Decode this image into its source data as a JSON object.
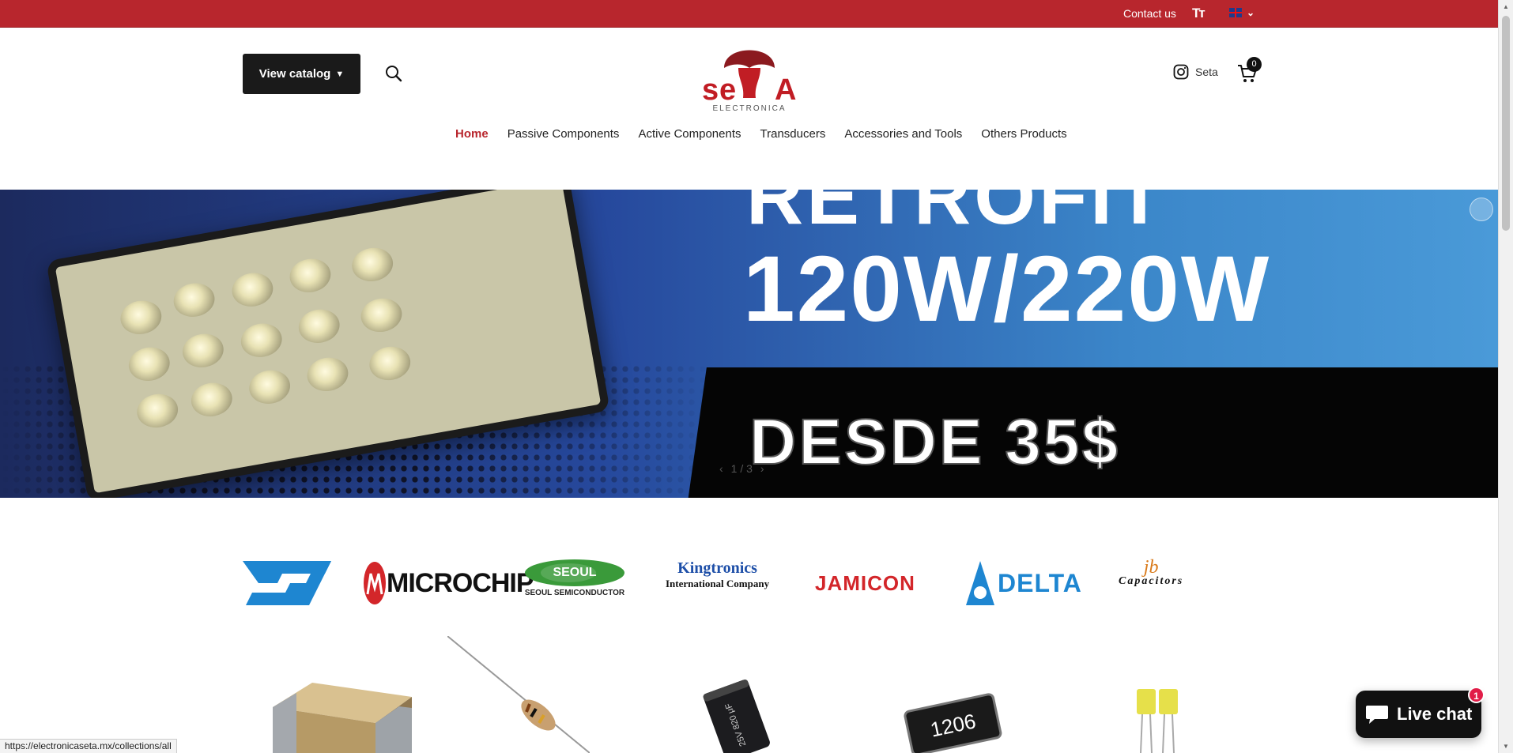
{
  "topbar": {
    "contact_label": "Contact us",
    "textsize_icon": "text-size-icon",
    "language_icon": "uk-flag-icon"
  },
  "header": {
    "catalog_label": "View catalog",
    "search_icon": "search-icon",
    "logo_text": "SETA",
    "logo_subtext": "ELECTRONICA",
    "instagram_label": "Seta",
    "cart_count": "0"
  },
  "nav": {
    "items": [
      {
        "label": "Home",
        "active": true
      },
      {
        "label": "Passive Components"
      },
      {
        "label": "Active Components"
      },
      {
        "label": "Transducers"
      },
      {
        "label": "Accessories and Tools"
      },
      {
        "label": "Others Products"
      }
    ]
  },
  "hero": {
    "line1": "RETROFIT",
    "line2": "120W/220W",
    "line3": "DESDE 35$",
    "pager": "1 / 3",
    "colors": {
      "blue_dark": "#1c2a5e",
      "blue_light": "#4a9ad8"
    }
  },
  "brands": {
    "microchip": "MICROCHIP",
    "seoul_top": "SEOUL",
    "seoul_bottom": "SEOUL SEMICONDUCTOR",
    "king_top": "Kingtronics",
    "king_bottom": "International Company",
    "jamicon": "JAMICON",
    "delta": "DELTA",
    "jb_top": "jb",
    "jb_bottom": "Capacitors"
  },
  "products": {
    "smd_resistor_label": "1206",
    "capacitor_label": "25V 820 μF"
  },
  "status_url": "https://electronicaseta.mx/collections/all",
  "chat": {
    "label": "Live chat",
    "badge": "1"
  },
  "colors": {
    "accent": "#b8262d",
    "dark": "#1a1a1a"
  }
}
